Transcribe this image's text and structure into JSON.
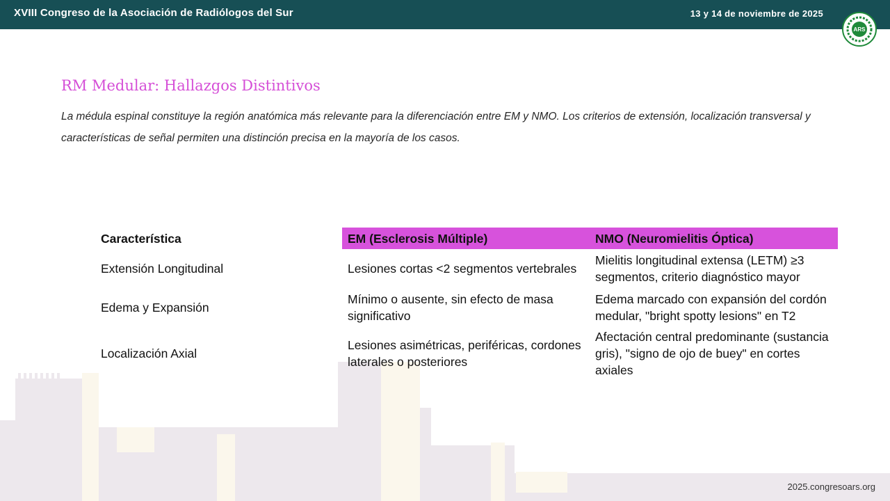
{
  "header": {
    "event_title": "XVIII Congreso de la Asociación de Radiólogos del Sur",
    "dates": "13 y 14 de noviembre de 2025",
    "logo_text": "ARS"
  },
  "slide": {
    "title": "RM Medular: Hallazgos Distintivos",
    "intro": "La médula espinal constituye la región anatómica más relevante para la diferenciación entre EM y NMO. Los criterios de extensión, localización transversal y características  de señal permiten una distinción precisa en la mayoría de los casos."
  },
  "table": {
    "headers": [
      "Característica",
      "EM (Esclerosis Múltiple)",
      "NMO (Neuromielitis Óptica)"
    ],
    "rows": [
      [
        "Extensión Longitudinal",
        "Lesiones cortas <2 segmentos vertebrales",
        "Mielitis longitudinal extensa (LETM) ≥3 segmentos, criterio diagnóstico mayor"
      ],
      [
        "Edema y Expansión",
        "Mínimo o ausente, sin efecto de masa significativo",
        "Edema marcado con expansión del cordón medular, \"bright spotty lesions\" en T2"
      ],
      [
        "Localización Axial",
        "Lesiones asimétricas, periféricas, cordones laterales o posteriores",
        "Afectación central predominante (sustancia gris), \"signo de ojo de buey\" en cortes axiales"
      ]
    ]
  },
  "footer": {
    "url": "2025.congresoars.org"
  },
  "colors": {
    "header_bg": "#174f55",
    "accent": "#d54fd7",
    "header_highlight": "#d752dc",
    "logo_green": "#1f8a3a"
  }
}
